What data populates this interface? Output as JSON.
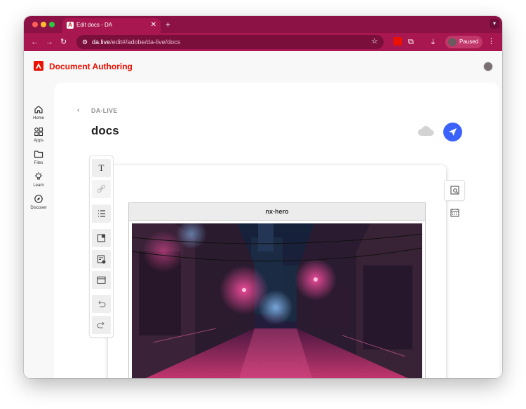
{
  "browser": {
    "tab_title": "Edit docs - DA",
    "url_host": "da.live",
    "url_path": "/edit#/adobe/da-live/docs",
    "profile_label": "Paused",
    "traffic_colors": [
      "#ff5f57",
      "#febc2e",
      "#28c840"
    ],
    "theme_color": "#a8174f"
  },
  "app": {
    "brand": "Document Authoring",
    "brand_color": "#eb1000"
  },
  "sidenav": {
    "items": [
      {
        "label": "Home",
        "icon": "home-icon"
      },
      {
        "label": "Apps",
        "icon": "apps-icon"
      },
      {
        "label": "Files",
        "icon": "folder-icon"
      },
      {
        "label": "Learn",
        "icon": "lightbulb-icon"
      },
      {
        "label": "Discover",
        "icon": "compass-icon"
      }
    ]
  },
  "editor": {
    "breadcrumb": "DA-LIVE",
    "title": "docs",
    "block_name": "nx-hero",
    "publish_color": "#3b63fb"
  },
  "toolbar_buttons": [
    {
      "name": "text-format-button",
      "icon": "text-icon"
    },
    {
      "name": "link-button",
      "icon": "link-icon"
    },
    {
      "name": "list-button",
      "icon": "list-icon"
    },
    {
      "name": "insert-image-button",
      "icon": "image-icon"
    },
    {
      "name": "insert-block-button",
      "icon": "block-icon"
    },
    {
      "name": "section-button",
      "icon": "section-icon"
    },
    {
      "name": "undo-button",
      "icon": "undo-icon"
    },
    {
      "name": "redo-button",
      "icon": "redo-icon"
    }
  ]
}
